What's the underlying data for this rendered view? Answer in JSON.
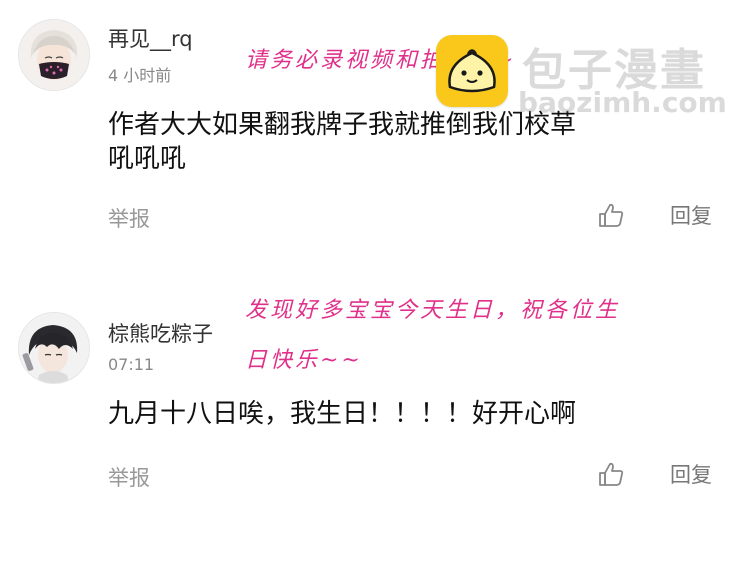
{
  "comments": [
    {
      "username": "再见__rq",
      "time": "4 小时前",
      "body_line1": "作者大大如果翻我牌子我就推倒我们校草",
      "body_line2": "吼吼吼",
      "report_label": "举报",
      "reply_label": "回复"
    },
    {
      "username": "棕熊吃粽子",
      "time": "07:11",
      "body_line1": "九月十八日唉，我生日！！！！好开心啊",
      "report_label": "举报",
      "reply_label": "回复"
    }
  ],
  "annotations": {
    "note1": "请务必录视频和拍照片~",
    "note2_line1": "发现好多宝宝今天生日，祝各位生",
    "note2_line2": "日快乐~~"
  },
  "watermark": {
    "title": "包子漫畫",
    "domain": "baozimh.com"
  },
  "colors": {
    "note_pink": "#e0318a",
    "logo_yellow": "#f9c81a",
    "muted_text": "#999999"
  },
  "icons": [
    "avatar-mask-boy",
    "avatar-dark-hair-boy",
    "thumbs-up-icon",
    "baozi-logo"
  ]
}
